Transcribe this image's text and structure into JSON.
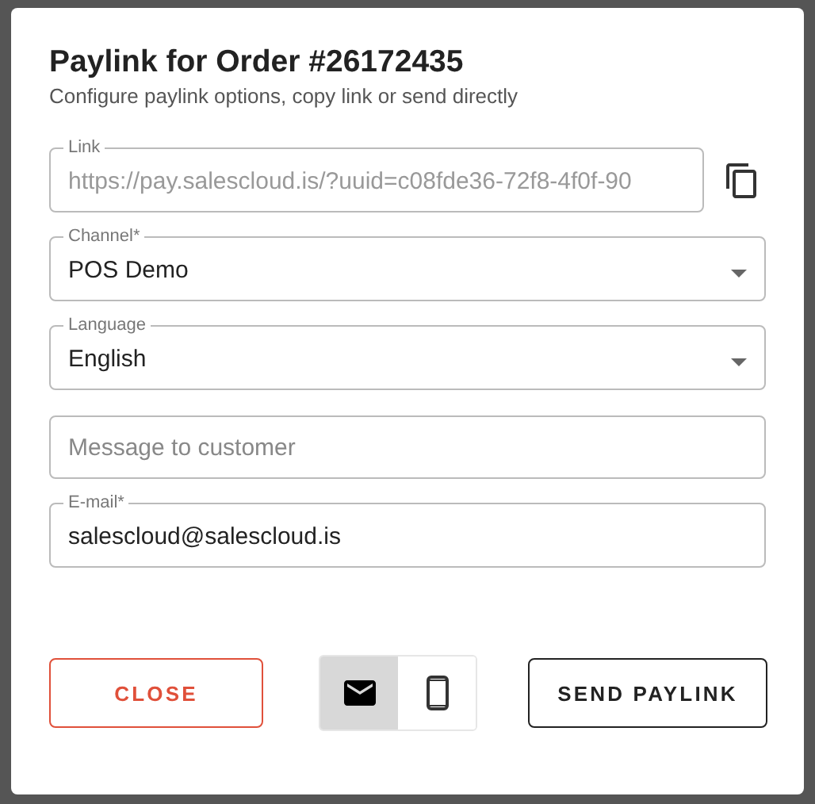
{
  "dialog": {
    "title": "Paylink for Order #26172435",
    "subtitle": "Configure paylink options, copy link or send directly"
  },
  "fields": [
    {
      "kind": "readonly",
      "label": "Link",
      "value": "https://pay.salescloud.is/?uuid=c08fde36-72f8-4f0f-90",
      "disabled": true
    },
    {
      "kind": "select",
      "label": "Channel*",
      "value": "POS Demo",
      "disabled": false
    },
    {
      "kind": "select",
      "label": "Language",
      "value": "English",
      "disabled": false
    },
    {
      "kind": "text",
      "placeholder": "Message to customer",
      "disabled": false
    },
    {
      "kind": "text",
      "label": "E-mail*",
      "value": "salescloud@salescloud.is",
      "disabled": false
    }
  ],
  "actions": {
    "close": "CLOSE",
    "send": "SEND PAYLINK"
  },
  "send_method": [
    {
      "kind": "email",
      "selected": true
    },
    {
      "kind": "phone",
      "selected": false
    }
  ]
}
